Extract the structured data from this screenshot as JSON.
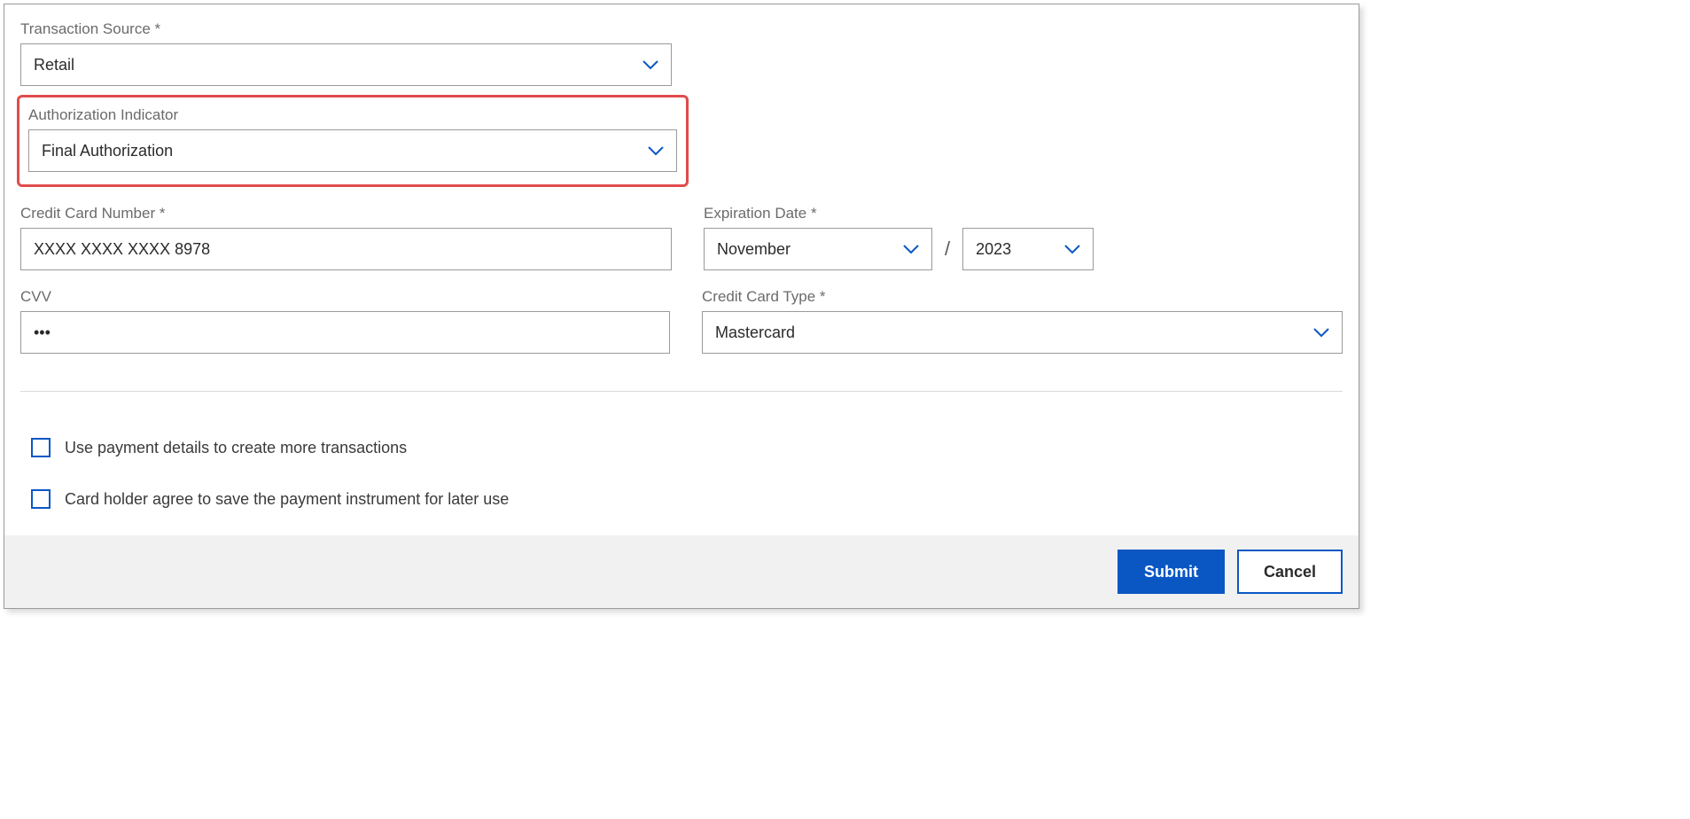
{
  "transactionSource": {
    "label": "Transaction Source *",
    "value": "Retail"
  },
  "authorizationIndicator": {
    "label": "Authorization Indicator",
    "value": "Final Authorization"
  },
  "creditCardNumber": {
    "label": "Credit Card Number *",
    "value": "XXXX XXXX XXXX 8978"
  },
  "expirationDate": {
    "label": "Expiration Date *",
    "month": "November",
    "separator": "/",
    "year": "2023"
  },
  "cvv": {
    "label": "CVV",
    "value": "•••"
  },
  "creditCardType": {
    "label": "Credit Card Type *",
    "value": "Mastercard"
  },
  "checkboxes": {
    "moreTransactions": "Use payment details to create more transactions",
    "saveInstrument": "Card holder agree to save the payment instrument for later use"
  },
  "buttons": {
    "submit": "Submit",
    "cancel": "Cancel"
  }
}
